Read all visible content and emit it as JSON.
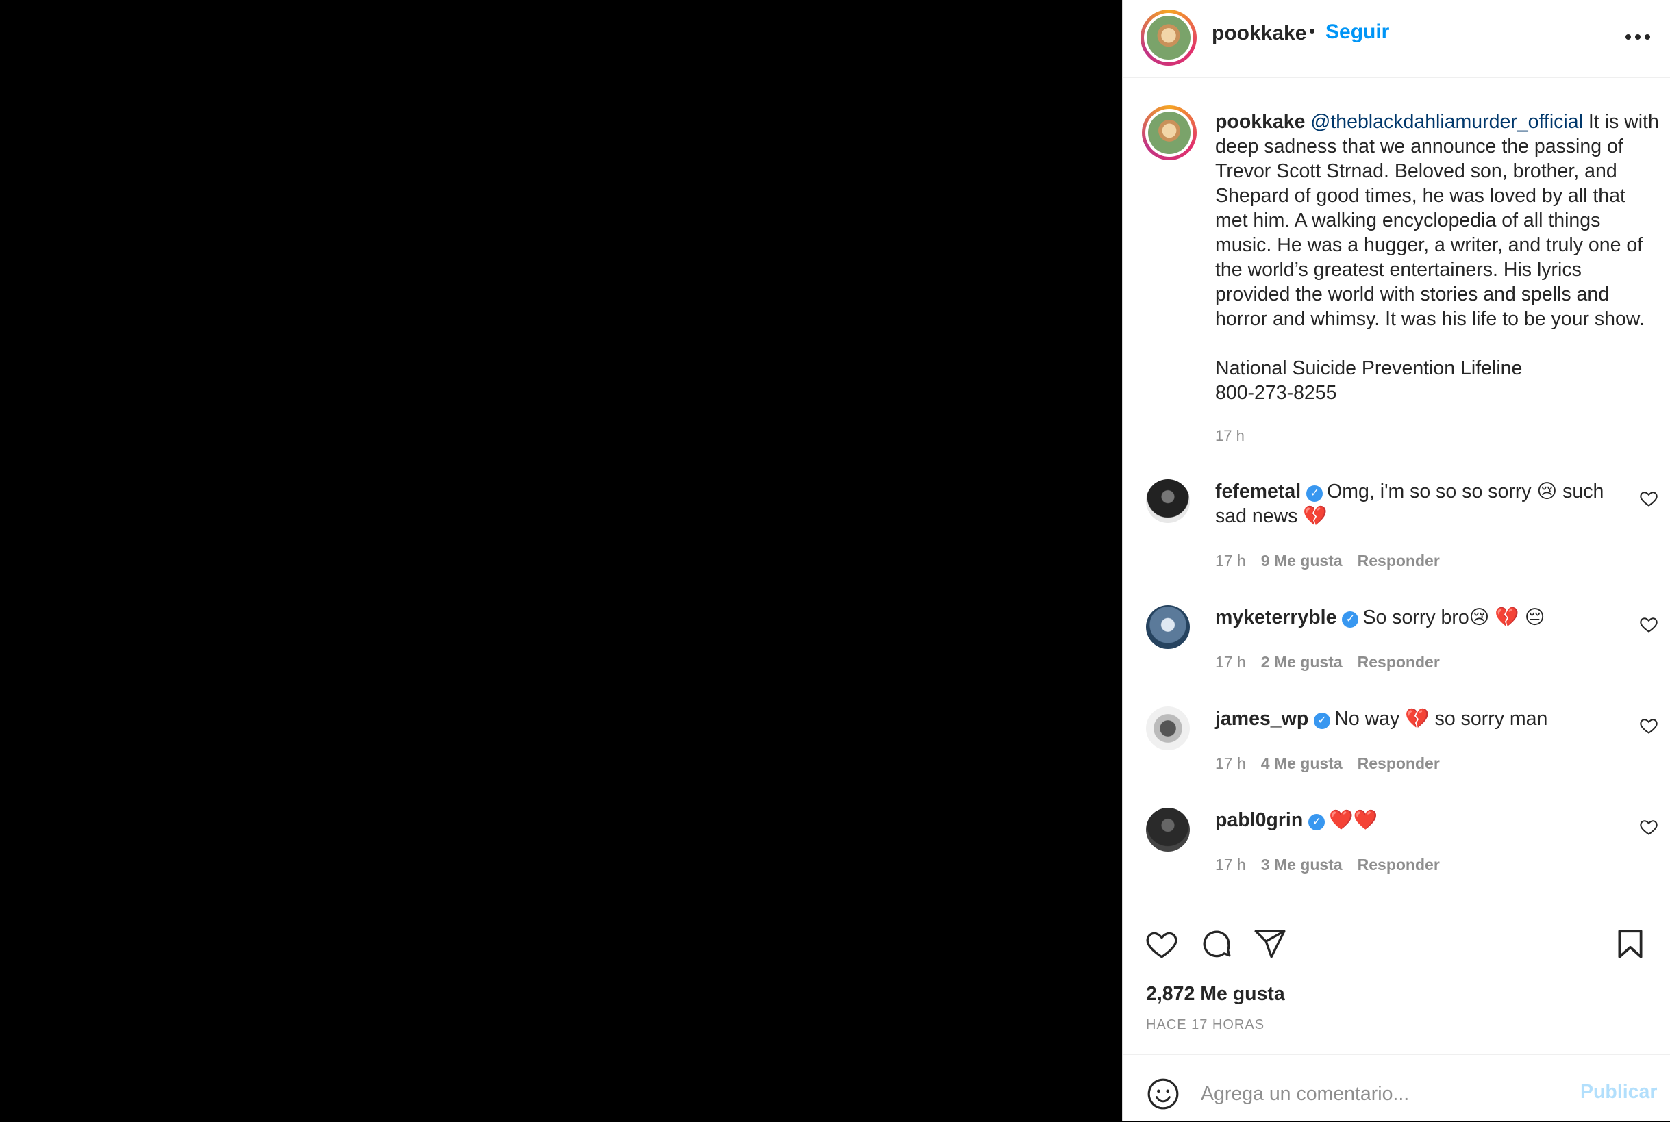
{
  "header": {
    "username": "pookkake",
    "separator": "•",
    "follow_label": "Seguir",
    "more_label": "..."
  },
  "caption": {
    "username": "pookkake",
    "mention": "@theblackdahliamurder_official",
    "text": "It is with deep sadness that we announce the passing of Trevor Scott Strnad. Beloved son, brother, and Shepard of good times, he was loved by all that met him. A walking encyclopedia of all things music. He was a hugger, a writer, and truly one of the world’s greatest entertainers. His lyrics provided the world with stories and spells and horror and whimsy. It was his life to be your show.",
    "line2": "National Suicide Prevention Lifeline",
    "line3": "800-273-8255",
    "time": "17 h"
  },
  "comments": [
    {
      "username": "fefemetal",
      "text": "Omg, i'm so so so sorry 😢 such sad news 💔",
      "time": "17 h",
      "likes": "9 Me gusta",
      "reply": "Responder"
    },
    {
      "username": "myketerryble",
      "text": "So sorry bro😢 💔 😔",
      "time": "17 h",
      "likes": "2 Me gusta",
      "reply": "Responder"
    },
    {
      "username": "james_wp",
      "text": "No way 💔 so sorry man",
      "time": "17 h",
      "likes": "4 Me gusta",
      "reply": "Responder"
    },
    {
      "username": "pabl0grin",
      "text": "❤️❤️",
      "time": "17 h",
      "likes": "3 Me gusta",
      "reply": "Responder"
    }
  ],
  "actions": {
    "likes": "2,872 Me gusta",
    "ago": "HACE 17 HORAS"
  },
  "comment_box": {
    "placeholder": "Agrega un comentario...",
    "publish_label": "Publicar"
  },
  "colors": {
    "link": "#0095f6",
    "mention": "#00376b",
    "muted": "#8e8e8e",
    "verified": "#3897f0",
    "publish_disabled": "#b2dffc"
  }
}
